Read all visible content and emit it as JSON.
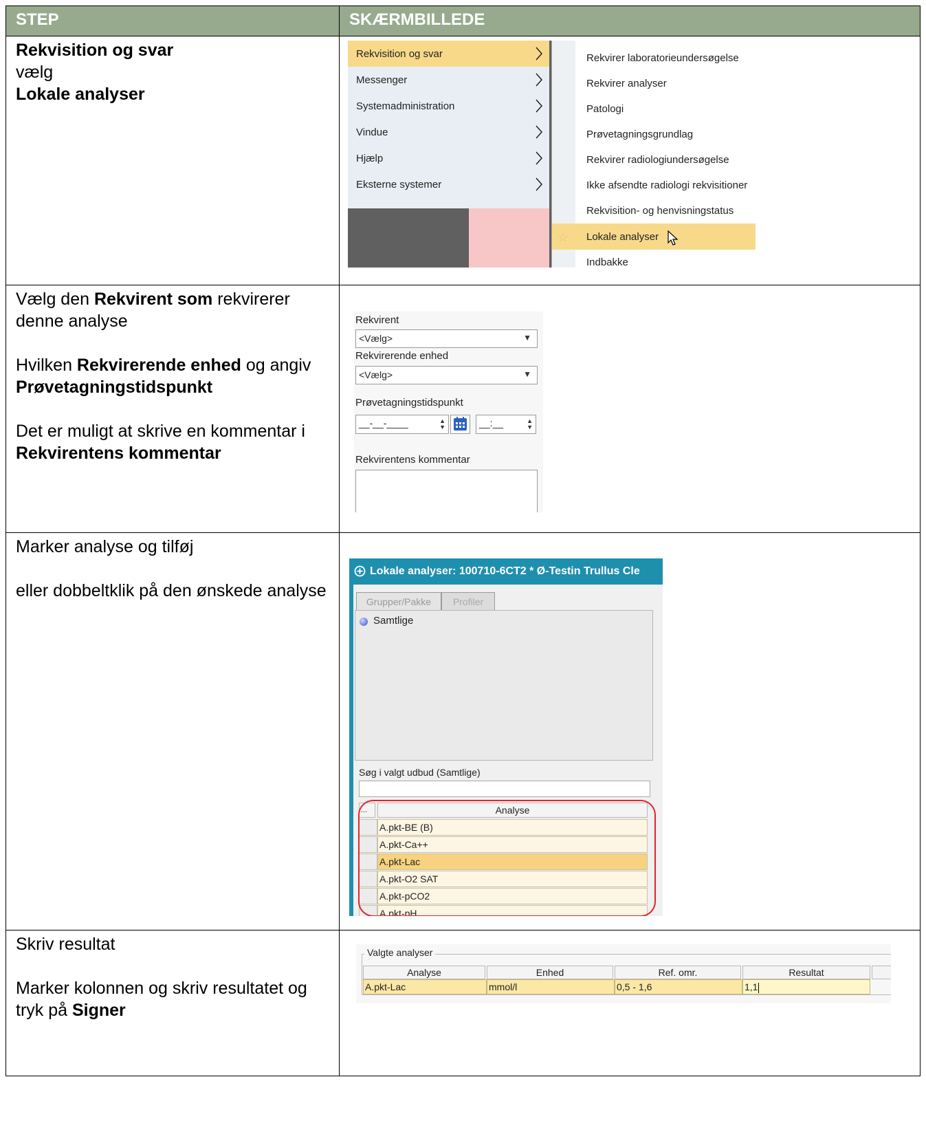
{
  "header": {
    "step_label": "STEP",
    "screenshot_label": "SKÆRMBILLEDE"
  },
  "colors": {
    "header_bg": "#97aa8e",
    "menu_highlight": "#f8d98a",
    "dialog_title_bg": "#1f8fae",
    "selection_ring": "#e0262a"
  },
  "rows": [
    {
      "step": {
        "line1": "Rekvisition og svar",
        "line2": "vælg",
        "line3": "Lokale analyser"
      },
      "menu": {
        "items": [
          "Rekvisition og svar",
          "Messenger",
          "Systemadministration",
          "Vindue",
          "Hjælp",
          "Eksterne systemer"
        ],
        "highlighted_item": "Rekvisition og svar",
        "submenu": [
          "Rekvirer laboratorieundersøgelse",
          "Rekvirer analyser",
          "Patologi",
          "Prøvetagningsgrundlag",
          "Rekvirer radiologiundersøgelse",
          "Ikke afsendte radiologi rekvisitioner",
          "Rekvisition- og henvisningstatus",
          "Lokale analyser",
          "Indbakke"
        ],
        "highlighted_submenu": "Lokale analyser",
        "icons": [
          "chevron-right-icon",
          "star-icon",
          "mouse-cursor-icon"
        ]
      }
    },
    {
      "step": {
        "p1_a": "Vælg den ",
        "p1_b": "Rekvirent som",
        "p1_c": " rekvirerer denne analyse",
        "p2_a": "Hvilken ",
        "p2_b": "Rekvirerende enhed",
        "p2_c": " og angiv ",
        "p2_d": "Prøvetagningstidspunkt",
        "p3_a": "Det er muligt at skrive en kommentar i",
        "p3_b": "Rekvirentens kommentar"
      },
      "form": {
        "rekvirent_label": "Rekvirent",
        "rekvirent_value": "<Vælg>",
        "enhed_label": "Rekvirerende enhed",
        "enhed_value": "<Vælg>",
        "tidspunkt_label": "Prøvetagningstidspunkt",
        "date_mask": "__-__-____",
        "time_mask": "__:__",
        "kommentar_label": "Rekvirentens kommentar",
        "icons": [
          "dropdown-arrow-icon",
          "spinner-icon",
          "calendar-icon"
        ]
      }
    },
    {
      "step": {
        "line1": "Marker analyse og tilføj",
        "line2": "eller dobbeltklik på den ønskede analyse"
      },
      "dialog": {
        "title": "Lokale analyser: 100710-6CT2 * Ø-Testin Trullus Cle",
        "tabs": [
          "Grupper/Pakke",
          "Profiler"
        ],
        "group_item": "Samtlige",
        "search_label": "Søg i valgt udbud (Samtlige)",
        "grid_corner": "...",
        "grid_header": "Analyse",
        "grid_rows": [
          "A.pkt-BE (B)",
          "A.pkt-Ca++",
          "A.pkt-Lac",
          "A.pkt-O2 SAT",
          "A.pkt-pCO2",
          "A.pkt-pH"
        ],
        "selected_row": "A.pkt-Lac",
        "icons": [
          "plus-circle-icon",
          "radio-sphere-icon"
        ]
      }
    },
    {
      "step": {
        "line1": "Skriv resultat",
        "line2_a": "Marker kolonnen og skriv resultatet og tryk på ",
        "line2_b": "Signer"
      },
      "result": {
        "legend": "Valgte analyser",
        "headers": [
          "Analyse",
          "Enhed",
          "Ref. omr.",
          "Resultat"
        ],
        "row": {
          "analyse": "A.pkt-Lac",
          "enhed": "mmol/l",
          "ref": "0,5 - 1,6",
          "resultat": "1,1"
        }
      }
    }
  ]
}
